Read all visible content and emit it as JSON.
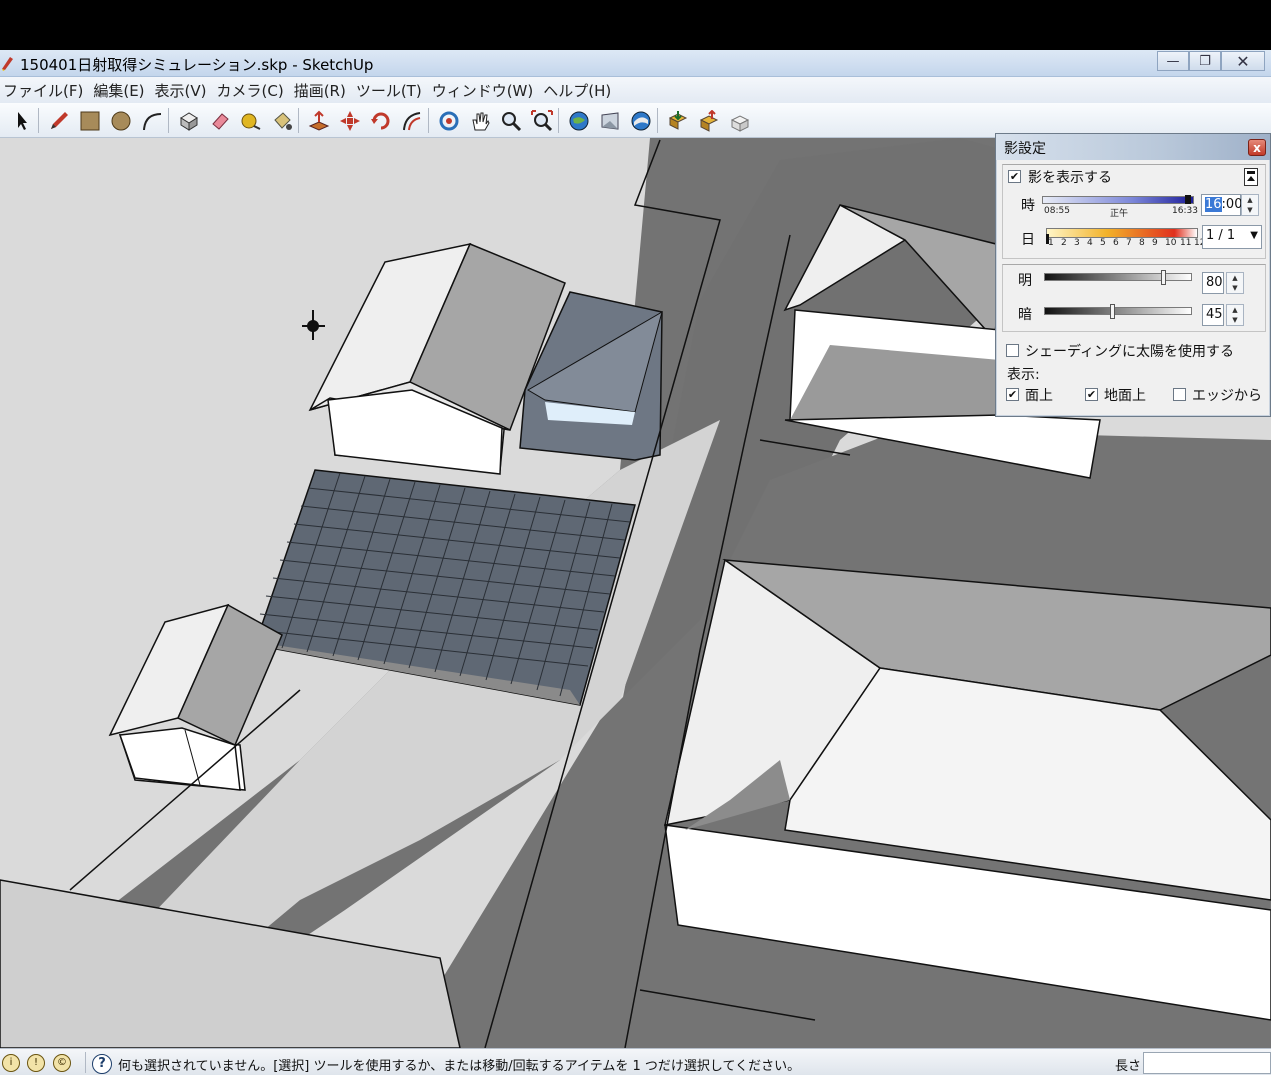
{
  "window": {
    "title": "150401日射取得シミュレーション.skp - SketchUp",
    "minimize_label": "▭",
    "restore_label": "❐",
    "close_label": "✕"
  },
  "menu": {
    "items": [
      {
        "label": "ファイル(F)"
      },
      {
        "label": "編集(E)"
      },
      {
        "label": "表示(V)"
      },
      {
        "label": "カメラ(C)"
      },
      {
        "label": "描画(R)"
      },
      {
        "label": "ツール(T)"
      },
      {
        "label": "ウィンドウ(W)"
      },
      {
        "label": "ヘルプ(H)"
      }
    ]
  },
  "toolbar": {
    "tools": [
      {
        "name": "select-tool",
        "icon": "arrow-icon"
      },
      {
        "name": "line-tool",
        "icon": "pencil-icon"
      },
      {
        "name": "rectangle-tool",
        "icon": "rectangle-icon"
      },
      {
        "name": "circle-tool",
        "icon": "circle-icon"
      },
      {
        "name": "arc-tool",
        "icon": "arc-icon"
      },
      {
        "name": "make-component-tool",
        "icon": "component-icon"
      },
      {
        "name": "eraser-tool",
        "icon": "eraser-icon"
      },
      {
        "name": "tape-measure-tool",
        "icon": "tape-measure-icon"
      },
      {
        "name": "paint-bucket-tool",
        "icon": "paint-bucket-icon"
      },
      {
        "name": "push-pull-tool",
        "icon": "push-pull-icon"
      },
      {
        "name": "move-tool",
        "icon": "move-icon"
      },
      {
        "name": "rotate-tool",
        "icon": "rotate-icon"
      },
      {
        "name": "offset-tool",
        "icon": "offset-icon"
      },
      {
        "name": "orbit-tool",
        "icon": "orbit-icon"
      },
      {
        "name": "pan-tool",
        "icon": "hand-icon"
      },
      {
        "name": "zoom-tool",
        "icon": "magnifier-icon"
      },
      {
        "name": "zoom-extents-tool",
        "icon": "zoom-extents-icon"
      },
      {
        "name": "previous-view-tool",
        "icon": "globe-icon"
      },
      {
        "name": "next-view-tool",
        "icon": "next-view-icon"
      },
      {
        "name": "position-camera-tool",
        "icon": "earth-icon"
      },
      {
        "name": "get-models-tool",
        "icon": "get-models-icon"
      },
      {
        "name": "share-model-tool",
        "icon": "share-model-icon"
      },
      {
        "name": "share-component-tool",
        "icon": "share-component-icon"
      }
    ]
  },
  "shadow_panel": {
    "title": "影設定",
    "close_label": "x",
    "show_shadows_label": "影を表示する",
    "show_shadows_checked": true,
    "time_label": "時",
    "time_start": "08:55",
    "time_noon": "正午",
    "time_end": "16:33",
    "time_value_highlight": "16",
    "time_value_rest": ":00",
    "date_label": "日",
    "date_ticks": [
      "1",
      "2",
      "3",
      "4",
      "5",
      "6",
      "7",
      "8",
      "9",
      "10",
      "11",
      "12"
    ],
    "date_value": "1 / 1",
    "light_label": "明",
    "light_value": "80",
    "light_fraction": 0.8,
    "dark_label": "暗",
    "dark_value": "45",
    "dark_fraction": 0.45,
    "use_sun_shading_label": "シェーディングに太陽を使用する",
    "use_sun_shading_checked": false,
    "display_label": "表示:",
    "on_faces_label": "面上",
    "on_faces_checked": true,
    "on_ground_label": "地面上",
    "on_ground_checked": true,
    "from_edges_label": "エッジから",
    "from_edges_checked": false
  },
  "status": {
    "message": "何も選択されていません。[選択] ツールを使用するか、または移動/回転するアイテムを 1 つだけ選択してください。",
    "length_label": "長さ",
    "length_value": "",
    "help_label": "?"
  },
  "colors": {
    "viewport_bg": "#dadada",
    "shadow": "#737373",
    "roof_light": "#efefef",
    "roof_dark": "#a6a6a6",
    "wall": "#ffffff",
    "solar_panel": "#5f6874",
    "glass": "#6e7784"
  }
}
